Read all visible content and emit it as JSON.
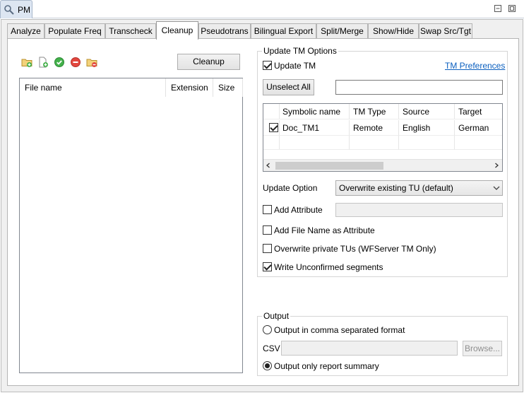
{
  "view": {
    "title": "PM",
    "minimize_icon": "minimize-icon",
    "maximize_icon": "maximize-icon"
  },
  "tabs": [
    {
      "label": "Analyze"
    },
    {
      "label": "Populate Freq"
    },
    {
      "label": "Transcheck"
    },
    {
      "label": "Cleanup",
      "active": true
    },
    {
      "label": "Pseudotrans"
    },
    {
      "label": "Bilingual Export"
    },
    {
      "label": "Split/Merge"
    },
    {
      "label": "Show/Hide"
    },
    {
      "label": "Swap Src/Tgt"
    }
  ],
  "left": {
    "toolbar_icons": [
      "add-folder-icon",
      "add-file-icon",
      "check-icon",
      "remove-icon",
      "remove-folder-icon"
    ],
    "cleanup_button": "Cleanup",
    "file_columns": [
      "File name",
      "Extension",
      "Size"
    ]
  },
  "update_tm": {
    "group_label": "Update TM Options",
    "update_tm_label": "Update TM",
    "update_tm_checked": true,
    "preferences_link": "TM Preferences",
    "unselect_all": "Unselect All",
    "filter_value": "",
    "table_columns": [
      "Symbolic name",
      "TM Type",
      "Source",
      "Target"
    ],
    "table_rows": [
      {
        "checked": true,
        "name": "Doc_TM1",
        "type": "Remote",
        "source": "English",
        "target": "German"
      }
    ],
    "update_option_label": "Update Option",
    "update_option_value": "Overwrite existing TU (default)",
    "add_attribute_label": "Add Attribute",
    "add_attribute_checked": false,
    "add_filename_label": "Add File Name as Attribute",
    "add_filename_checked": false,
    "overwrite_private_label": "Overwrite private TUs (WFServer TM Only)",
    "overwrite_private_checked": false,
    "write_unconfirmed_label": "Write Unconfirmed segments",
    "write_unconfirmed_checked": true
  },
  "output": {
    "group_label": "Output",
    "csv_option_label": "Output in comma separated format",
    "csv_option_selected": false,
    "csv_label": "CSV",
    "csv_value": "",
    "browse_button": "Browse...",
    "summary_option_label": "Output only report summary",
    "summary_option_selected": true
  },
  "colors": {
    "link": "#0b5fbf",
    "active_tab": "#ffffff",
    "tab": "#ececec"
  }
}
